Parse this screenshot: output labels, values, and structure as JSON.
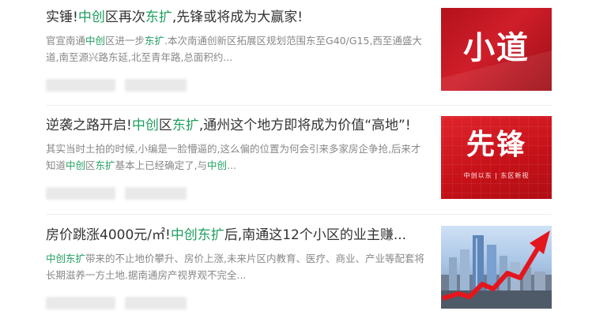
{
  "articles": [
    {
      "title": [
        {
          "t": "实锤!",
          "hl": false
        },
        {
          "t": "中创",
          "hl": true
        },
        {
          "t": "区再次",
          "hl": false
        },
        {
          "t": "东扩",
          "hl": true
        },
        {
          "t": ",先锋或将成为大赢家!",
          "hl": false
        }
      ],
      "summary": [
        {
          "t": "官宣南通",
          "hl": false
        },
        {
          "t": "中创",
          "hl": true
        },
        {
          "t": "区进一步",
          "hl": false
        },
        {
          "t": "东扩",
          "hl": true
        },
        {
          "t": ".本次南通创新区拓展区规划范围东至G40/G15,西至通盛大道,南至源兴路东延,北至青年路,总面积约...",
          "hl": false
        }
      ],
      "thumb_text": "小道"
    },
    {
      "title": [
        {
          "t": "逆袭之路开启!",
          "hl": false
        },
        {
          "t": "中创",
          "hl": true
        },
        {
          "t": "区",
          "hl": false
        },
        {
          "t": "东扩",
          "hl": true
        },
        {
          "t": ",通州这个地方即将成为价值“高地”!",
          "hl": false
        }
      ],
      "summary": [
        {
          "t": "其实当时土拍的时候,小编是一脸懵逼的,这么偏的位置为何会引来多家房企争抢,后来才知道",
          "hl": false
        },
        {
          "t": "中创",
          "hl": true
        },
        {
          "t": "区",
          "hl": false
        },
        {
          "t": "东扩",
          "hl": true
        },
        {
          "t": "基本上已经确定了,与",
          "hl": false
        },
        {
          "t": "中创",
          "hl": true
        },
        {
          "t": "...",
          "hl": false
        }
      ],
      "thumb_text": "先锋",
      "thumb_sub": "中创以东 | 东区新视"
    },
    {
      "title": [
        {
          "t": "房价跳涨4000元/㎡!",
          "hl": false
        },
        {
          "t": "中创东扩",
          "hl": true
        },
        {
          "t": "后,南通这12个小区的业主赚...",
          "hl": false
        }
      ],
      "summary": [
        {
          "t": "中创东扩",
          "hl": true
        },
        {
          "t": "带来的不止地价攀升、房价上涨,未来片区内教育、医疗、商业、产业等配套将长期滋养一方土地.据南通房产视界观不完全...",
          "hl": false
        }
      ]
    }
  ],
  "colors": {
    "highlight": "#1f9f5f",
    "title": "#333333",
    "summary": "#888888"
  }
}
